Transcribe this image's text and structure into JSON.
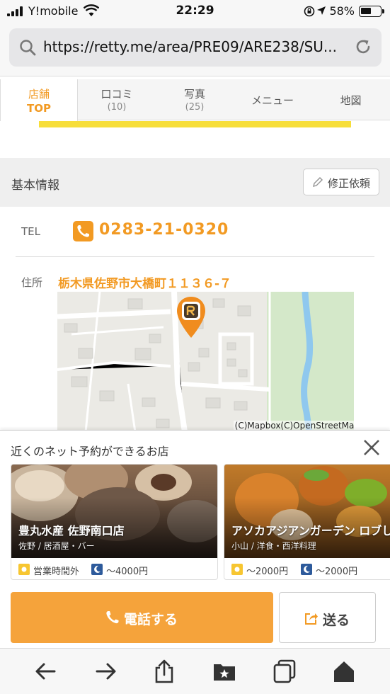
{
  "status_bar": {
    "carrier": "Y!mobile",
    "time": "22:29",
    "battery": "58%",
    "battery_level": 0.58
  },
  "browser": {
    "url": "https://retty.me/area/PRE09/ARE238/SU..."
  },
  "tabs": [
    {
      "label": "店舗",
      "sub": "TOP",
      "active": true
    },
    {
      "label": "口コミ",
      "sub": "(10)"
    },
    {
      "label": "写真",
      "sub": "(25)"
    },
    {
      "label": "メニュー",
      "sub": ""
    },
    {
      "label": "地図",
      "sub": ""
    }
  ],
  "basic_info": {
    "title": "基本情報",
    "edit_label": "修正依頼",
    "tel_label": "TEL",
    "tel": "0283-21-0320",
    "address_label": "住所",
    "address": "栃木県佐野市大橋町１１３６-７",
    "map_credit": "(C)Mapbox(C)OpenStreetMap"
  },
  "nearby": {
    "title": "近くのネット予約ができるお店",
    "cards": [
      {
        "name": "豊丸水産 佐野南口店",
        "genre": "佐野 / 居酒屋・バー",
        "lunch": "営業時間外",
        "dinner": "〜4000円"
      },
      {
        "name": "アソカアジアンガーデン ロブし",
        "genre": "小山 / 洋食・西洋料理",
        "lunch": "〜2000円",
        "dinner": "〜2000円"
      }
    ]
  },
  "actions": {
    "call_label": "電話する",
    "send_label": "送る"
  },
  "colors": {
    "accent": "#f29a23",
    "call_button": "#f5a33b",
    "highlight_bar": "#f7de3a"
  }
}
